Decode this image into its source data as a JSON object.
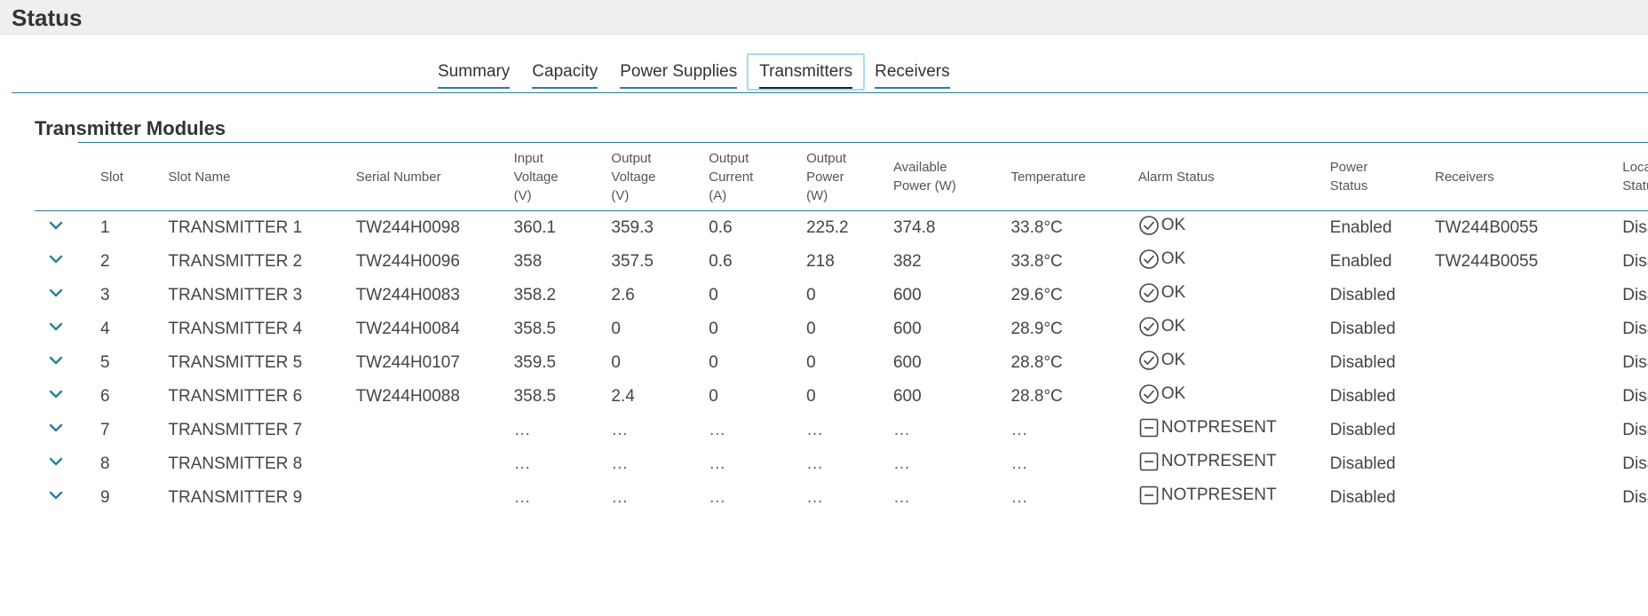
{
  "header": {
    "title": "Status"
  },
  "tabs": [
    {
      "label": "Summary",
      "active": false
    },
    {
      "label": "Capacity",
      "active": false
    },
    {
      "label": "Power Supplies",
      "active": false
    },
    {
      "label": "Transmitters",
      "active": true
    },
    {
      "label": "Receivers",
      "active": false
    }
  ],
  "section": {
    "title": "Transmitter Modules"
  },
  "columns": [
    {
      "key": "expand",
      "label": ""
    },
    {
      "key": "slot",
      "label": "Slot"
    },
    {
      "key": "slot_name",
      "label": "Slot Name"
    },
    {
      "key": "serial",
      "label": "Serial Number"
    },
    {
      "key": "in_v",
      "label": "Input\nVoltage\n(V)"
    },
    {
      "key": "out_v",
      "label": "Output\nVoltage\n(V)"
    },
    {
      "key": "out_a",
      "label": "Output\nCurrent\n(A)"
    },
    {
      "key": "out_w",
      "label": "Output\nPower\n(W)"
    },
    {
      "key": "avail_w",
      "label": "Available\nPower (W)"
    },
    {
      "key": "temp",
      "label": "Temperature"
    },
    {
      "key": "alarm",
      "label": "Alarm Status"
    },
    {
      "key": "power",
      "label": "Power\nStatus"
    },
    {
      "key": "receivers",
      "label": "Receivers"
    },
    {
      "key": "local",
      "label": "Loca\nStatu"
    }
  ],
  "icons": {
    "expand": "chevron-down-icon",
    "ok": "check-circle-icon",
    "notpresent": "minus-square-icon"
  },
  "colors": {
    "accent": "#2a7f9a",
    "active_tab_border": "#a8dce9"
  },
  "rows": [
    {
      "slot": "1",
      "slot_name": "TRANSMITTER 1",
      "serial": "TW244H0098",
      "in_v": "360.1",
      "out_v": "359.3",
      "out_a": "0.6",
      "out_w": "225.2",
      "avail_w": "374.8",
      "temp": "33.8°C",
      "alarm": "OK",
      "alarm_icon": "ok",
      "power": "Enabled",
      "receivers": "TW244B0055",
      "local": "Disa"
    },
    {
      "slot": "2",
      "slot_name": "TRANSMITTER 2",
      "serial": "TW244H0096",
      "in_v": "358",
      "out_v": "357.5",
      "out_a": "0.6",
      "out_w": "218",
      "avail_w": "382",
      "temp": "33.8°C",
      "alarm": "OK",
      "alarm_icon": "ok",
      "power": "Enabled",
      "receivers": "TW244B0055",
      "local": "Disa"
    },
    {
      "slot": "3",
      "slot_name": "TRANSMITTER 3",
      "serial": "TW244H0083",
      "in_v": "358.2",
      "out_v": "2.6",
      "out_a": "0",
      "out_w": "0",
      "avail_w": "600",
      "temp": "29.6°C",
      "alarm": "OK",
      "alarm_icon": "ok",
      "power": "Disabled",
      "receivers": "",
      "local": "Disa"
    },
    {
      "slot": "4",
      "slot_name": "TRANSMITTER 4",
      "serial": "TW244H0084",
      "in_v": "358.5",
      "out_v": "0",
      "out_a": "0",
      "out_w": "0",
      "avail_w": "600",
      "temp": "28.9°C",
      "alarm": "OK",
      "alarm_icon": "ok",
      "power": "Disabled",
      "receivers": "",
      "local": "Disa"
    },
    {
      "slot": "5",
      "slot_name": "TRANSMITTER 5",
      "serial": "TW244H0107",
      "in_v": "359.5",
      "out_v": "0",
      "out_a": "0",
      "out_w": "0",
      "avail_w": "600",
      "temp": "28.8°C",
      "alarm": "OK",
      "alarm_icon": "ok",
      "power": "Disabled",
      "receivers": "",
      "local": "Disa"
    },
    {
      "slot": "6",
      "slot_name": "TRANSMITTER 6",
      "serial": "TW244H0088",
      "in_v": "358.5",
      "out_v": "2.4",
      "out_a": "0",
      "out_w": "0",
      "avail_w": "600",
      "temp": "28.8°C",
      "alarm": "OK",
      "alarm_icon": "ok",
      "power": "Disabled",
      "receivers": "",
      "local": "Disa"
    },
    {
      "slot": "7",
      "slot_name": "TRANSMITTER 7",
      "serial": "",
      "in_v": "…",
      "out_v": "…",
      "out_a": "…",
      "out_w": "…",
      "avail_w": "…",
      "temp": "…",
      "alarm": "NOTPRESENT",
      "alarm_icon": "notpresent",
      "power": "Disabled",
      "receivers": "",
      "local": "Disa"
    },
    {
      "slot": "8",
      "slot_name": "TRANSMITTER 8",
      "serial": "",
      "in_v": "…",
      "out_v": "…",
      "out_a": "…",
      "out_w": "…",
      "avail_w": "…",
      "temp": "…",
      "alarm": "NOTPRESENT",
      "alarm_icon": "notpresent",
      "power": "Disabled",
      "receivers": "",
      "local": "Disa"
    },
    {
      "slot": "9",
      "slot_name": "TRANSMITTER 9",
      "serial": "",
      "in_v": "…",
      "out_v": "…",
      "out_a": "…",
      "out_w": "…",
      "avail_w": "…",
      "temp": "…",
      "alarm": "NOTPRESENT",
      "alarm_icon": "notpresent",
      "power": "Disabled",
      "receivers": "",
      "local": "Disa"
    }
  ]
}
